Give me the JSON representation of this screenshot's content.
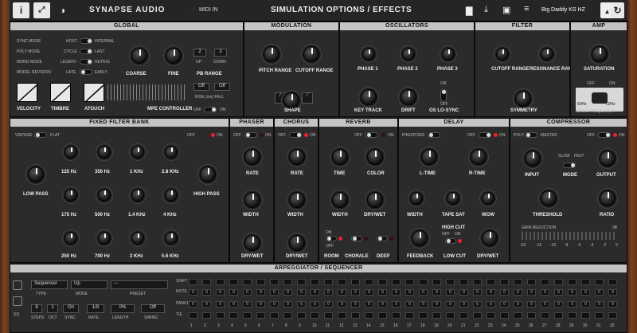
{
  "topbar": {
    "info_icon": "i",
    "brand": "SYNAPSE AUDIO",
    "midi_in": "MIDI IN",
    "title": "SIMULATION OPTIONS / EFFECTS",
    "preset": "Big Daddy KS HZ"
  },
  "global": {
    "title": "GLOBAL",
    "sync_mode": "SYNC MODE",
    "host": "HOST",
    "internal": "INTERNAL",
    "poly_mode": "POLY MODE",
    "cycle": "CYCLE",
    "last": "LAST",
    "mono_mode": "MONO MODE",
    "legato": "LEGATO",
    "retrig": "RETRIG",
    "model_revision": "MODEL REVISION",
    "late": "LATE",
    "early": "EARLY",
    "coarse": "COARSE",
    "fine": "FINE",
    "pb_range": "PB RANGE",
    "pb_up_val": "2",
    "pb_down_val": "2",
    "up": "UP",
    "down": "DOWN",
    "rise_val": "Off",
    "fall_val": "Off",
    "rise_fall": "RISE (ms) FALL",
    "velocity": "VELOCITY",
    "timbre": "TIMBRE",
    "atouch": "ATOUCH",
    "mpe": "MPE CONTROLLER",
    "off": "OFF",
    "on": "ON"
  },
  "modulation": {
    "title": "MODULATION",
    "pitch_range": "PITCH RANGE",
    "cutoff_range": "CUTOFF RANGE",
    "shape": "SHAPE"
  },
  "oscillators": {
    "title": "OSCILLATORS",
    "phase1": "PHASE 1",
    "phase2": "PHASE 2",
    "phase3": "PHASE 3",
    "key_track": "KEY TRACK",
    "drift": "DRIFT",
    "os_lo_sync": "OS LO-SYNC",
    "on": "ON",
    "off": "OFF",
    "free": "FREE"
  },
  "filter": {
    "title": "FILTER",
    "cutoff_range": "CUTOFF RANGE",
    "resonance_range": "RESONANCE RANGE",
    "symmetry": "SYMMETRY"
  },
  "amp": {
    "title": "AMP",
    "saturation": "SATURATION",
    "off": "OFF",
    "on": "ON",
    "hz60": "60Hz",
    "hz50": "50Hz",
    "mains": "MAINS FREQUENCY"
  },
  "ffb": {
    "title": "FIXED FILTER BANK",
    "vintage": "VINTAGE",
    "flat": "FLAT",
    "off": "OFF",
    "on": "ON",
    "bands": [
      "125 Hz",
      "350 Hz",
      "1 KHz",
      "2.8 KHz",
      "175 Hz",
      "500 Hz",
      "1.4 KHz",
      "4 KHz",
      "250 Hz",
      "700 Hz",
      "2 KHz",
      "5.6 KHz"
    ],
    "low_pass": "LOW PASS",
    "high_pass": "HIGH PASS"
  },
  "phaser": {
    "title": "PHASER",
    "off": "OFF",
    "on": "ON",
    "rate": "RATE",
    "width": "WIDTH",
    "dry_wet": "DRY/WET"
  },
  "chorus": {
    "title": "CHORUS",
    "off": "OFF",
    "on": "ON",
    "rate": "RATE",
    "width": "WIDTH",
    "dry_wet": "DRY/WET"
  },
  "reverb": {
    "title": "REVERB",
    "off": "OFF",
    "on": "ON",
    "time": "TIME",
    "color": "COLOR",
    "width": "WIDTH",
    "dry_wet": "DRY/WET",
    "room": "ROOM",
    "chorale": "CHORALE",
    "deep": "DEEP"
  },
  "delay": {
    "title": "DELAY",
    "ping_pong": "PING/PONG",
    "off": "OFF",
    "on": "ON",
    "l_time": "L-TIME",
    "r_time": "R-TIME",
    "width": "WIDTH",
    "tape_sat": "TAPE SAT",
    "wow": "WOW",
    "feedback": "FEEDBACK",
    "high_cut": "HIGH CUT",
    "low_cut": "LOW CUT",
    "dry_wet": "DRY/WET"
  },
  "compressor": {
    "title": "COMPRESSOR",
    "poly": "POLY",
    "master": "MASTER",
    "off": "OFF",
    "on": "ON",
    "input": "INPUT",
    "mode": "MODE",
    "slow": "SLOW",
    "fast": "FAST",
    "output": "OUTPUT",
    "threshold": "THRESHOLD",
    "ratio": "RATIO",
    "gain_reduction": "GAIN REDUCTION",
    "db": "dB",
    "gr_scale": [
      "-20",
      "-15",
      "-10",
      "-8",
      "-6",
      "-4",
      "-2",
      "0"
    ]
  },
  "arp": {
    "title": "ARPEGGIATOR / SEQUENCER",
    "type_val": "Sequencer",
    "mode_val": "Up",
    "preset_val": "---",
    "type": "TYPE",
    "mode": "MODE",
    "preset": "PRESET",
    "steps_val": "8",
    "oct_val": "1",
    "sync_val": "On",
    "rate_val": "1/8",
    "length_val": "0%",
    "swing_val": "Off",
    "steps": "STEPS",
    "oct": "OCT",
    "sync": "SYNC",
    "rate": "RATE",
    "length": "LENGTH",
    "swing": "SWING",
    "rows": [
      "SHIFT",
      "NOTE",
      "PAN#1",
      "TIE"
    ],
    "step_numbers": [
      "1",
      "2",
      "3",
      "4",
      "5",
      "6",
      "7",
      "8",
      "9",
      "10",
      "11",
      "12",
      "13",
      "14",
      "15",
      "16",
      "17",
      "18",
      "19",
      "20",
      "21",
      "22",
      "23",
      "24",
      "25",
      "26",
      "27",
      "28",
      "29",
      "30",
      "31",
      "32"
    ],
    "sq": "SQ"
  }
}
